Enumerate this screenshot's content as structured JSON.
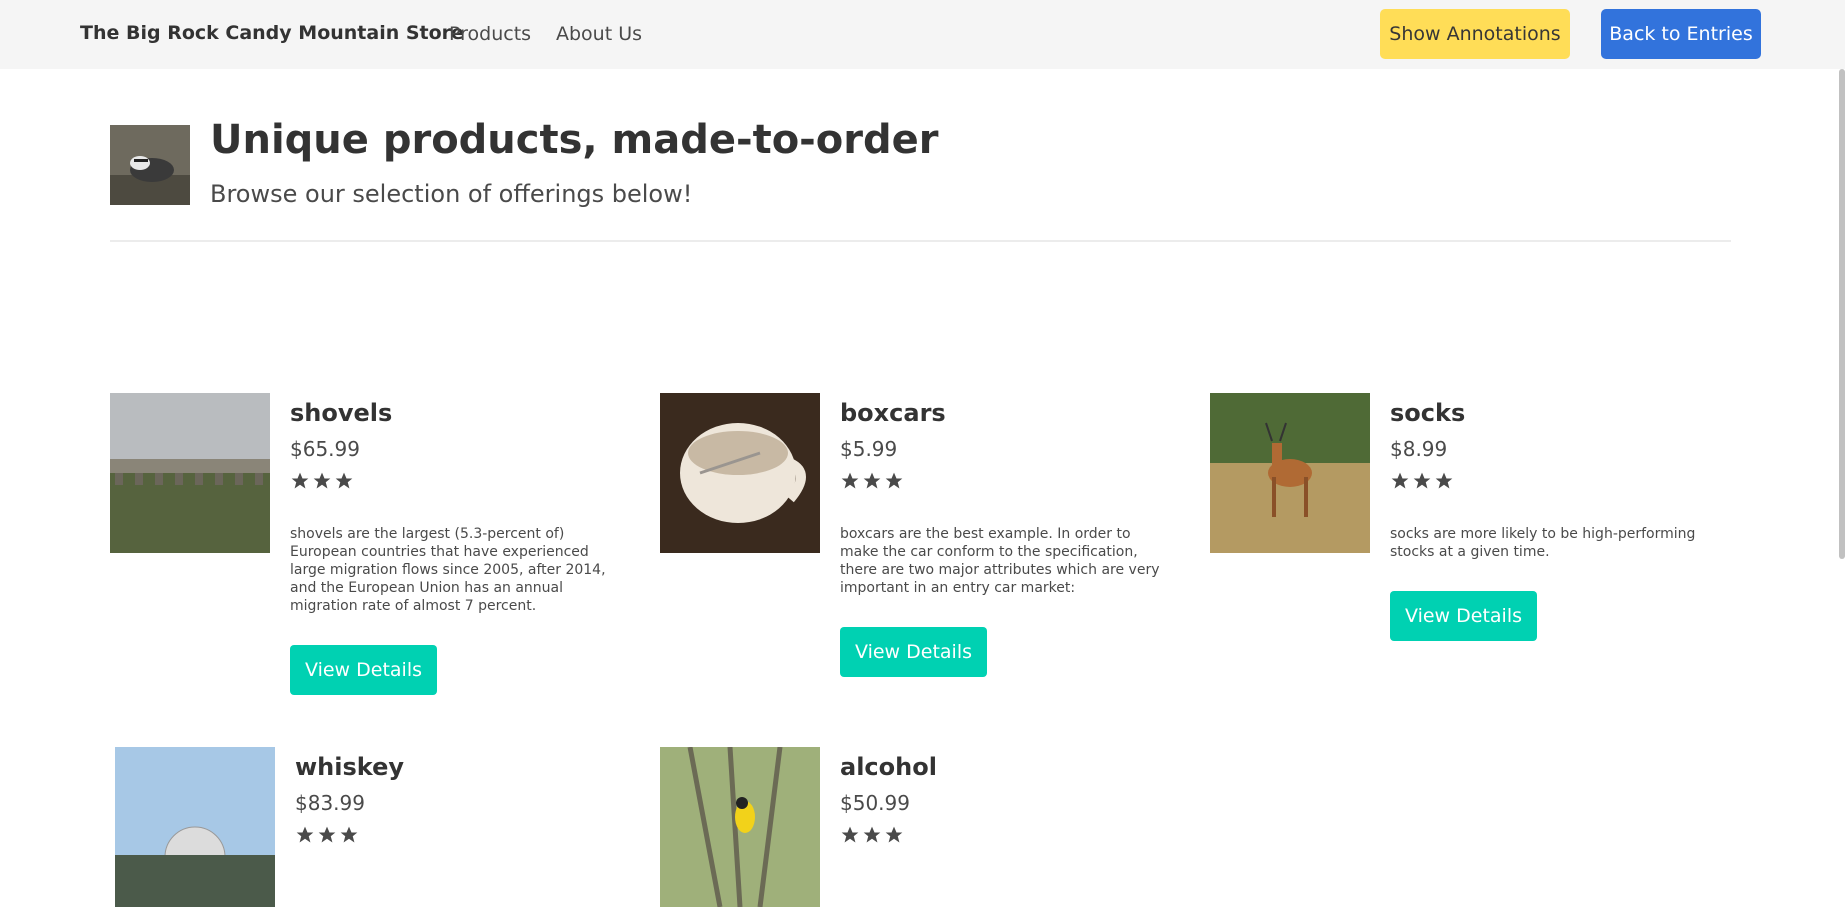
{
  "nav": {
    "brand": "The Big Rock Candy Mountain Store",
    "links": [
      "Products",
      "About Us"
    ],
    "show_annotations": "Show Annotations",
    "back_to_entries": "Back to Entries"
  },
  "hero": {
    "title": "Unique products, made-to-order",
    "subtitle": "Browse our selection of offerings below!"
  },
  "products": [
    {
      "name": "shovels",
      "price": "$65.99",
      "rating": 3,
      "description": "shovels are the largest (5.3-percent of) European countries that have experienced large migration flows since 2005, after 2014, and the European Union has an annual migration rate of almost 7 percent.",
      "button": "View Details"
    },
    {
      "name": "boxcars",
      "price": "$5.99",
      "rating": 3,
      "description": "boxcars are the best example. In order to make the car conform to the specification, there are two major attributes which are very important in an entry car market:",
      "button": "View Details"
    },
    {
      "name": "socks",
      "price": "$8.99",
      "rating": 3,
      "description": "socks are more likely to be high-performing stocks at a given time.",
      "button": "View Details"
    },
    {
      "name": "whiskey",
      "price": "$83.99",
      "rating": 3
    },
    {
      "name": "alcohol",
      "price": "$50.99",
      "rating": 3
    }
  ],
  "colors": {
    "navbar_bg": "#f5f5f5",
    "annotations_button": "#ffdd57",
    "back_button": "#3273dc",
    "view_details_button": "#00d1b2",
    "star": "#4a4a4a"
  }
}
